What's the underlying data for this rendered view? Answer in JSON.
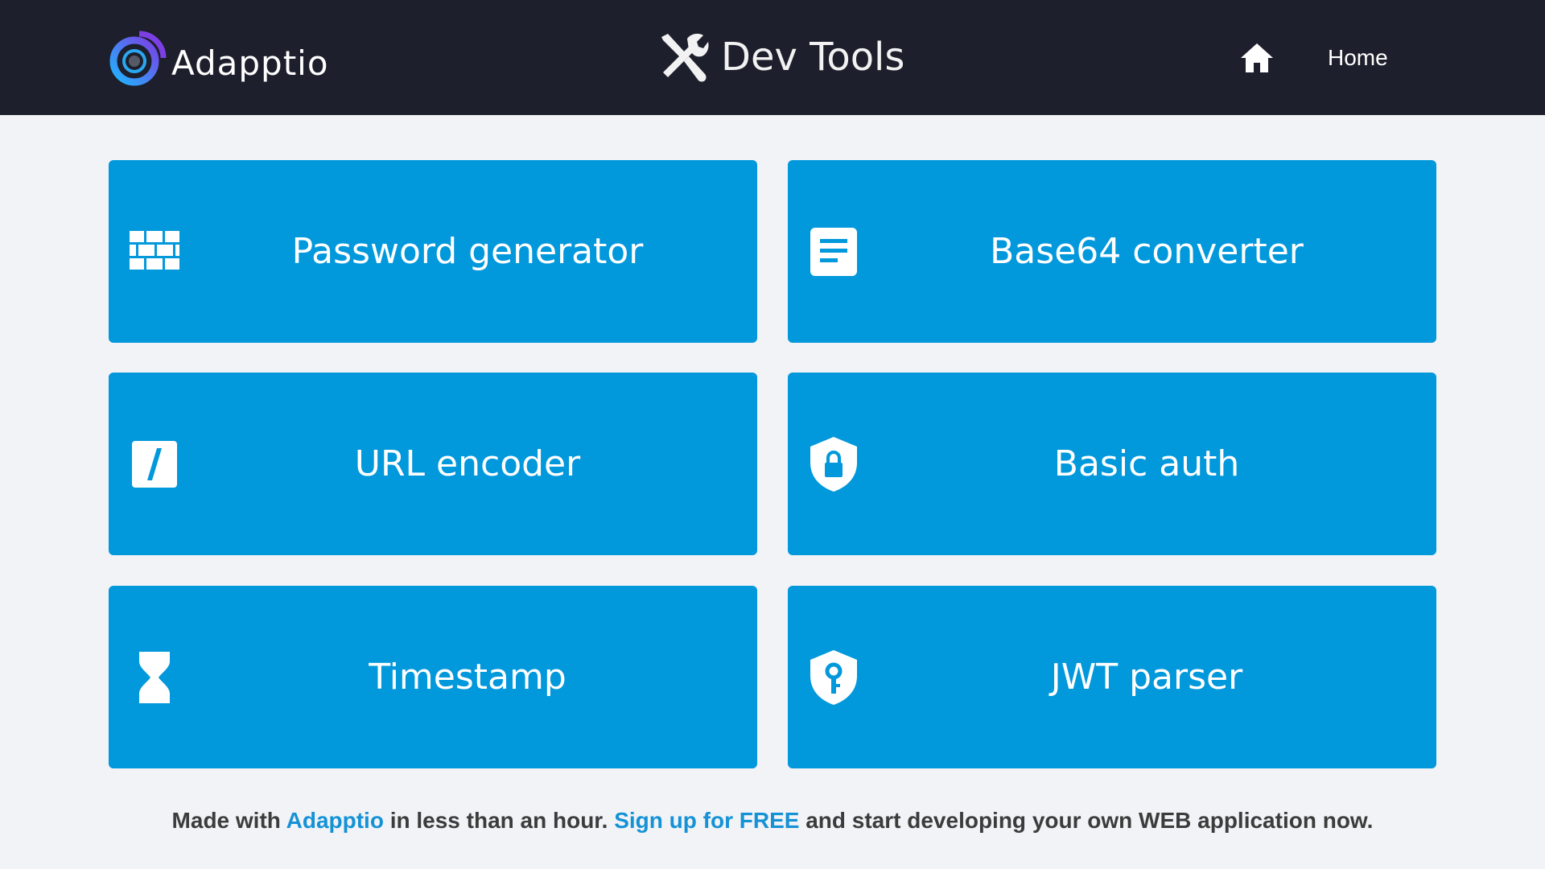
{
  "header": {
    "brand": "Adapptio",
    "title": "Dev Tools",
    "nav_home": "Home"
  },
  "tiles": [
    {
      "label": "Password generator",
      "icon": "brick-wall-icon"
    },
    {
      "label": "Base64 converter",
      "icon": "document-icon"
    },
    {
      "label": "URL encoder",
      "icon": "slash-icon"
    },
    {
      "label": "Basic auth",
      "icon": "shield-lock-icon"
    },
    {
      "label": "Timestamp",
      "icon": "hourglass-icon"
    },
    {
      "label": "JWT parser",
      "icon": "shield-key-icon"
    }
  ],
  "footer": {
    "text1": "Made with ",
    "link1": "Adapptio",
    "text2": " in less than an hour. ",
    "link2": "Sign up for FREE",
    "text3": " and start developing your own WEB application now."
  },
  "colors": {
    "header_bg": "#1d1f2c",
    "page_bg": "#f1f3f6",
    "tile_bg": "#0298dc",
    "link": "#1592d6"
  }
}
